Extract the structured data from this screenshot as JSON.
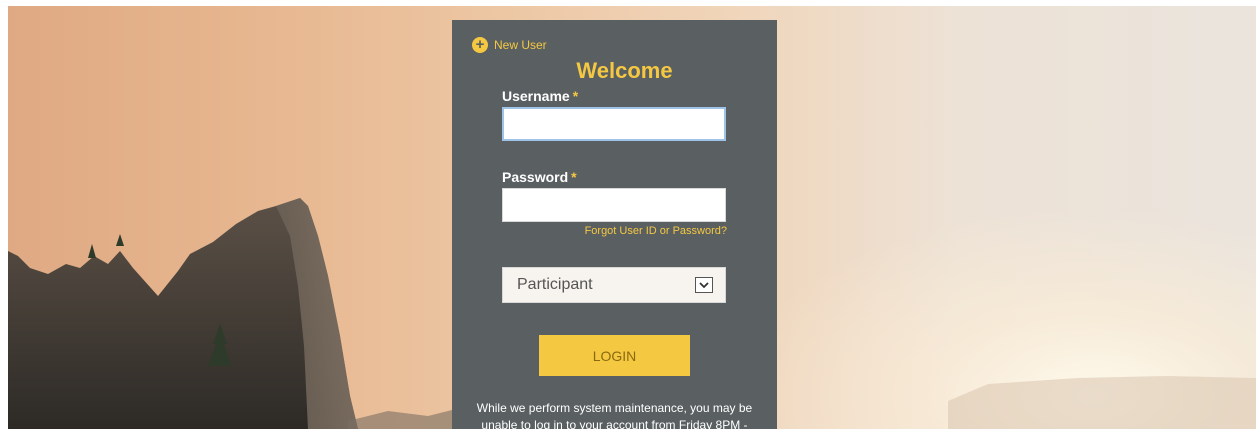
{
  "login": {
    "new_user_label": "New User",
    "welcome": "Welcome",
    "username_label": "Username",
    "password_label": "Password",
    "required_mark": "*",
    "username_value": "",
    "password_value": "",
    "forgot_link": "Forgot User ID or Password?",
    "role_selected": "Participant",
    "login_button": "LOGIN",
    "notice_line1": "While we perform system maintenance, you may be",
    "notice_line2": "unable to log in to your account from Friday 8PM -"
  },
  "colors": {
    "accent": "#f5c842",
    "panel": "#5a5f62"
  },
  "icons": {
    "new_user": "plus-circle-icon",
    "dropdown": "chevron-down-icon"
  }
}
